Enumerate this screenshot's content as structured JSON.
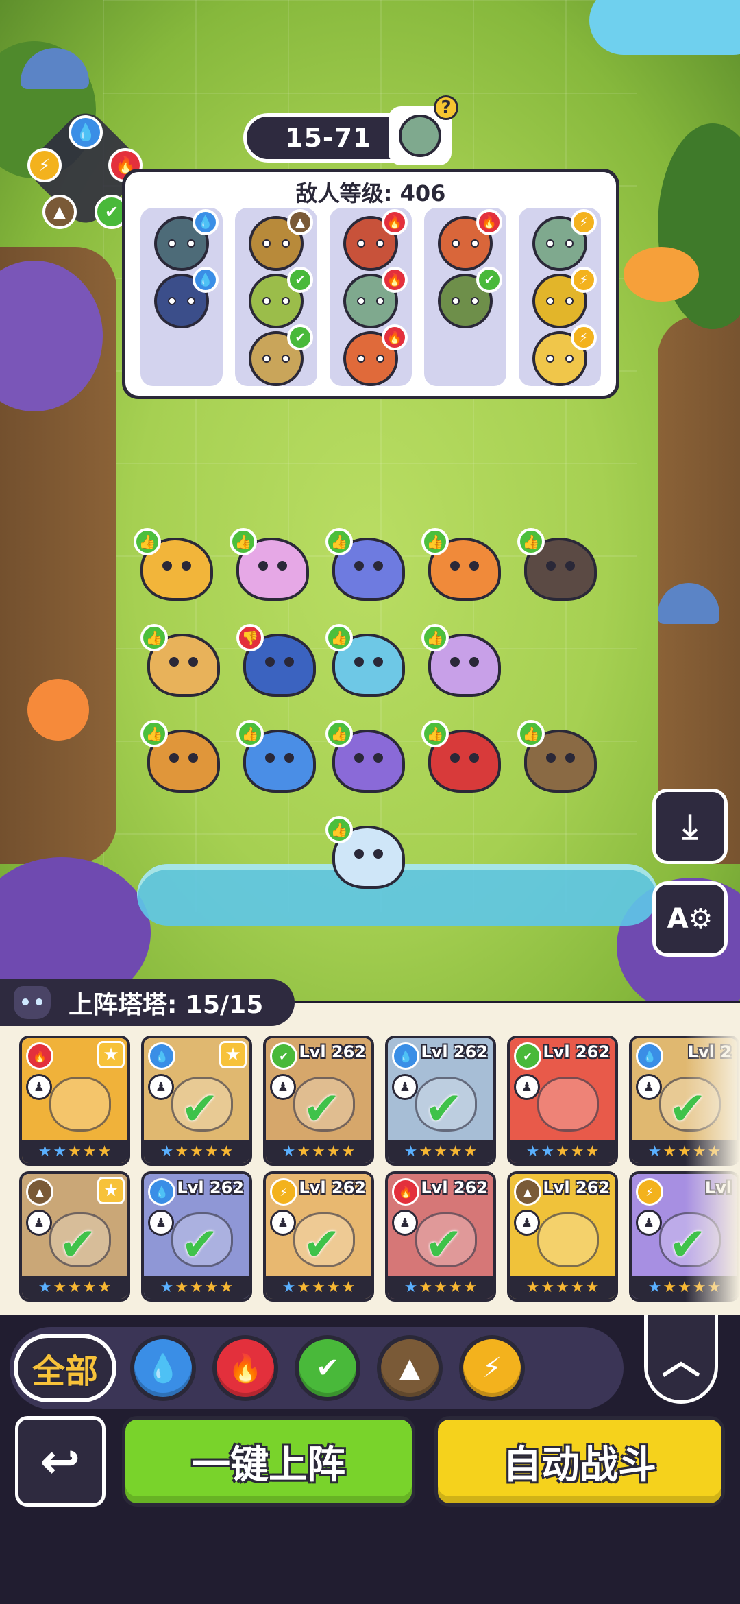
{
  "stage": {
    "label": "15-71"
  },
  "enemy_panel": {
    "title": "敌人等级: 406",
    "columns": [
      {
        "enemies": [
          {
            "color": "#4d6b78",
            "element": "water"
          },
          {
            "color": "#3b4e8a",
            "element": "water"
          }
        ]
      },
      {
        "enemies": [
          {
            "color": "#b88a3a",
            "element": "earth"
          },
          {
            "color": "#9bbd4a",
            "element": "leaf"
          },
          {
            "color": "#c9a55a",
            "element": "leaf"
          }
        ]
      },
      {
        "enemies": [
          {
            "color": "#c8523a",
            "element": "fire"
          },
          {
            "color": "#7fa98e",
            "element": "fire"
          },
          {
            "color": "#e06a3a",
            "element": "fire"
          }
        ]
      },
      {
        "enemies": [
          {
            "color": "#d9663a",
            "element": "fire"
          },
          {
            "color": "#6e8f4a",
            "element": "leaf"
          }
        ]
      },
      {
        "enemies": [
          {
            "color": "#7fa98e",
            "element": "bolt"
          },
          {
            "color": "#e2b52a",
            "element": "bolt"
          },
          {
            "color": "#f0c64a",
            "element": "bolt"
          }
        ]
      }
    ]
  },
  "element_wheel": {
    "nodes": [
      {
        "element": "water",
        "glyph": "💧"
      },
      {
        "element": "fire",
        "glyph": "🔥"
      },
      {
        "element": "leaf",
        "glyph": "✔"
      },
      {
        "element": "earth",
        "glyph": "▲"
      },
      {
        "element": "bolt",
        "glyph": "⚡"
      }
    ]
  },
  "heroes": [
    {
      "color": "#f2b53a",
      "thumb": "up"
    },
    {
      "color": "#e6a8e6",
      "thumb": "up"
    },
    {
      "color": "#6e7be0",
      "thumb": "up"
    },
    {
      "color": "#f08a3a",
      "thumb": "up"
    },
    {
      "color": "#5b4a44",
      "thumb": "up"
    },
    {
      "color": "#e8b25a",
      "thumb": "up"
    },
    {
      "color": "#3b63c0",
      "thumb": "down"
    },
    {
      "color": "#6ec8e6",
      "thumb": "up"
    },
    {
      "color": "#c8a0e8",
      "thumb": "up"
    },
    {
      "color": "#e0963a",
      "thumb": "up"
    },
    {
      "color": "#4a8ee6",
      "thumb": "up"
    },
    {
      "color": "#8a6ad8",
      "thumb": "up"
    },
    {
      "color": "#d83a3a",
      "thumb": "up"
    },
    {
      "color": "#8a6a44",
      "thumb": "up"
    },
    {
      "color": "#cfe6f8",
      "thumb": "up"
    }
  ],
  "side_buttons": {
    "download_glyph": "⤓",
    "auto_glyph": "A⚙"
  },
  "roster": {
    "title": "上阵塔塔: 15/15",
    "cards": [
      {
        "bg": "#f0b23a",
        "element": "fire",
        "level": "",
        "selected": false,
        "star_badge": true,
        "stars": "blue"
      },
      {
        "bg": "#d6a040",
        "element": "water",
        "level": "",
        "selected": true,
        "star_badge": true,
        "stars": "mixed"
      },
      {
        "bg": "#c88a3a",
        "element": "leaf",
        "level": "Lvl 262",
        "selected": true,
        "star_badge": false,
        "stars": "mixed"
      },
      {
        "bg": "#8aa8c8",
        "element": "water",
        "level": "Lvl 262",
        "selected": true,
        "star_badge": false,
        "stars": "mixed"
      },
      {
        "bg": "#e85a4a",
        "element": "leaf",
        "level": "Lvl 262",
        "selected": false,
        "star_badge": false,
        "stars": "blue"
      },
      {
        "bg": "#d6a040",
        "element": "water",
        "level": "Lvl 2",
        "selected": true,
        "star_badge": false,
        "stars": "mixed"
      },
      {
        "bg": "#b88a4a",
        "element": "earth",
        "level": "",
        "selected": true,
        "star_badge": true,
        "stars": "mixed"
      },
      {
        "bg": "#6a74c8",
        "element": "water",
        "level": "Lvl 262",
        "selected": true,
        "star_badge": false,
        "stars": "mixed"
      },
      {
        "bg": "#e0a040",
        "element": "bolt",
        "level": "Lvl 262",
        "selected": true,
        "star_badge": false,
        "stars": "mixed"
      },
      {
        "bg": "#c84a4a",
        "element": "fire",
        "level": "Lvl 262",
        "selected": true,
        "star_badge": false,
        "stars": "mixed"
      },
      {
        "bg": "#f0c23a",
        "element": "earth",
        "level": "Lvl 262",
        "selected": false,
        "star_badge": false,
        "stars": "gold"
      },
      {
        "bg": "#8a6ad8",
        "element": "bolt",
        "level": "Lvl",
        "selected": true,
        "star_badge": false,
        "stars": "mixed"
      }
    ]
  },
  "filters": {
    "all_label": "全部",
    "items": [
      {
        "element": "water",
        "color": "#3a8ee6",
        "glyph": "💧"
      },
      {
        "element": "fire",
        "color": "#e3303c",
        "glyph": "🔥"
      },
      {
        "element": "leaf",
        "color": "#49b93a",
        "glyph": "✔"
      },
      {
        "element": "earth",
        "color": "#7a5a37",
        "glyph": "▲"
      },
      {
        "element": "bolt",
        "color": "#f3b21d",
        "glyph": "⚡"
      }
    ],
    "collapse_glyph": "︿"
  },
  "actions": {
    "back_glyph": "↩",
    "deploy_label": "一键上阵",
    "auto_battle_label": "自动战斗"
  }
}
